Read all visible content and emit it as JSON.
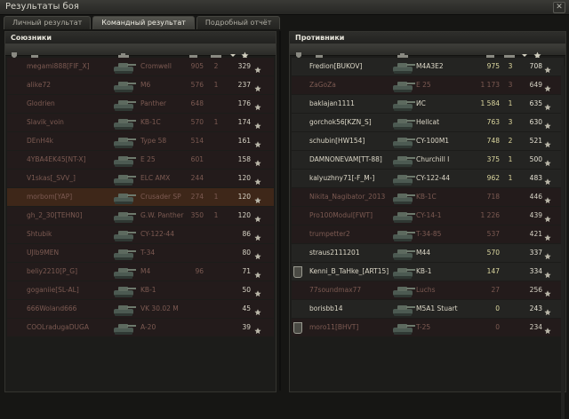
{
  "window": {
    "title": "Результаты боя"
  },
  "tabs": [
    {
      "label": "Личный результат"
    },
    {
      "label": "Командный результат"
    },
    {
      "label": "Подробный отчёт"
    }
  ],
  "allies": {
    "title": "Союзники",
    "rows": [
      {
        "player": "megami888[FIF_X]",
        "vehicle": "Cromwell",
        "damage": "905",
        "kills": "2",
        "xp": "329",
        "state": "dead"
      },
      {
        "player": "alike72",
        "vehicle": "M6",
        "damage": "576",
        "kills": "1",
        "xp": "237",
        "state": "dead"
      },
      {
        "player": "Glodrien",
        "vehicle": "Panther",
        "damage": "648",
        "kills": "",
        "xp": "176",
        "state": "dead"
      },
      {
        "player": "Slavik_voin",
        "vehicle": "KB-1C",
        "damage": "570",
        "kills": "1",
        "xp": "174",
        "state": "dead"
      },
      {
        "player": "DEnH4k",
        "vehicle": "Type 58",
        "damage": "514",
        "kills": "",
        "xp": "161",
        "state": "dead"
      },
      {
        "player": "4YBA4EK45[NT-X]",
        "vehicle": "E 25",
        "damage": "601",
        "kills": "",
        "xp": "158",
        "state": "dead"
      },
      {
        "player": "V1skas[_SVV_]",
        "vehicle": "ELC AMX",
        "damage": "244",
        "kills": "",
        "xp": "120",
        "state": "dead"
      },
      {
        "player": "morbom[YAP]",
        "vehicle": "Crusader SP",
        "damage": "274",
        "kills": "1",
        "xp": "120",
        "state": "highlight"
      },
      {
        "player": "gh_2_30[TEHN0]",
        "vehicle": "G.W. Panther",
        "damage": "350",
        "kills": "1",
        "xp": "120",
        "state": "dead"
      },
      {
        "player": "Shtubik",
        "vehicle": "CY-122-44",
        "damage": "",
        "kills": "",
        "xp": "86",
        "state": "dead"
      },
      {
        "player": "UJlb9MEN",
        "vehicle": "T-34",
        "damage": "",
        "kills": "",
        "xp": "80",
        "state": "dead"
      },
      {
        "player": "beliy2210[P_G]",
        "vehicle": "M4",
        "damage": "96",
        "kills": "",
        "xp": "71",
        "state": "dead"
      },
      {
        "player": "goganiie[SL-AL]",
        "vehicle": "KB-1",
        "damage": "",
        "kills": "",
        "xp": "50",
        "state": "dead"
      },
      {
        "player": "666Woland666",
        "vehicle": "VK 30.02 M",
        "damage": "",
        "kills": "",
        "xp": "45",
        "state": "dead"
      },
      {
        "player": "COOLradugaDUGA",
        "vehicle": "A-20",
        "damage": "",
        "kills": "",
        "xp": "39",
        "state": "dead"
      }
    ]
  },
  "enemies": {
    "title": "Противники",
    "rows": [
      {
        "player": "Fredion[BUKOV]",
        "vehicle": "M4A3E2",
        "damage": "975",
        "kills": "3",
        "xp": "708",
        "state": "alive",
        "badge": false
      },
      {
        "player": "ZaGoZa",
        "vehicle": "E 25",
        "damage": "1 173",
        "kills": "3",
        "xp": "649",
        "state": "dead",
        "badge": false
      },
      {
        "player": "baklajan1111",
        "vehicle": "ИС",
        "damage": "1 584",
        "kills": "1",
        "xp": "635",
        "state": "alive",
        "badge": false
      },
      {
        "player": "gorchok56[KZN_S]",
        "vehicle": "Hellcat",
        "damage": "763",
        "kills": "3",
        "xp": "630",
        "state": "alive",
        "badge": false
      },
      {
        "player": "schubin[HW154]",
        "vehicle": "CY-100M1",
        "damage": "748",
        "kills": "2",
        "xp": "521",
        "state": "alive",
        "badge": false
      },
      {
        "player": "DAMNONEVAM[TT-88]",
        "vehicle": "Churchill I",
        "damage": "375",
        "kills": "1",
        "xp": "500",
        "state": "alive",
        "badge": false
      },
      {
        "player": "kalyuzhny71[-F_M-]",
        "vehicle": "CY-122-44",
        "damage": "962",
        "kills": "1",
        "xp": "483",
        "state": "alive",
        "badge": false
      },
      {
        "player": "Nikita_Nagibator_2013",
        "vehicle": "KB-1C",
        "damage": "718",
        "kills": "",
        "xp": "446",
        "state": "dead",
        "badge": false
      },
      {
        "player": "Pro100Modul[FWT]",
        "vehicle": "CY-14-1",
        "damage": "1 226",
        "kills": "",
        "xp": "439",
        "state": "dead",
        "badge": false
      },
      {
        "player": "trumpetter2",
        "vehicle": "T-34-85",
        "damage": "537",
        "kills": "",
        "xp": "421",
        "state": "dead",
        "badge": false
      },
      {
        "player": "straus2111201",
        "vehicle": "M44",
        "damage": "570",
        "kills": "",
        "xp": "337",
        "state": "alive",
        "badge": false
      },
      {
        "player": "Kenni_B_TaHke_[ART15]",
        "vehicle": "KB-1",
        "damage": "147",
        "kills": "",
        "xp": "334",
        "state": "alive",
        "badge": true
      },
      {
        "player": "77soundmax77",
        "vehicle": "Luchs",
        "damage": "27",
        "kills": "",
        "xp": "256",
        "state": "dead",
        "badge": false
      },
      {
        "player": "borisbb14",
        "vehicle": "M5A1 Stuart",
        "damage": "0",
        "kills": "",
        "xp": "243",
        "state": "alive",
        "badge": false
      },
      {
        "player": "moro11[BHVT]",
        "vehicle": "T-25",
        "damage": "0",
        "kills": "",
        "xp": "234",
        "state": "dead",
        "badge": true
      }
    ]
  },
  "icons": {
    "header": [
      "badge-icon",
      "tank-class-icon",
      "vehicle-icon",
      "damage-icon",
      "kills-icon",
      "sort-arrow-icon",
      "xp-star-icon"
    ],
    "row": [
      "tank-image-icon",
      "xp-star-icon"
    ]
  },
  "colors": {
    "alive_text": "#ddd8c8",
    "dead_text": "#7c5a52",
    "highlight_row": "#3e2719",
    "damage_text": "#ddd8a0"
  }
}
